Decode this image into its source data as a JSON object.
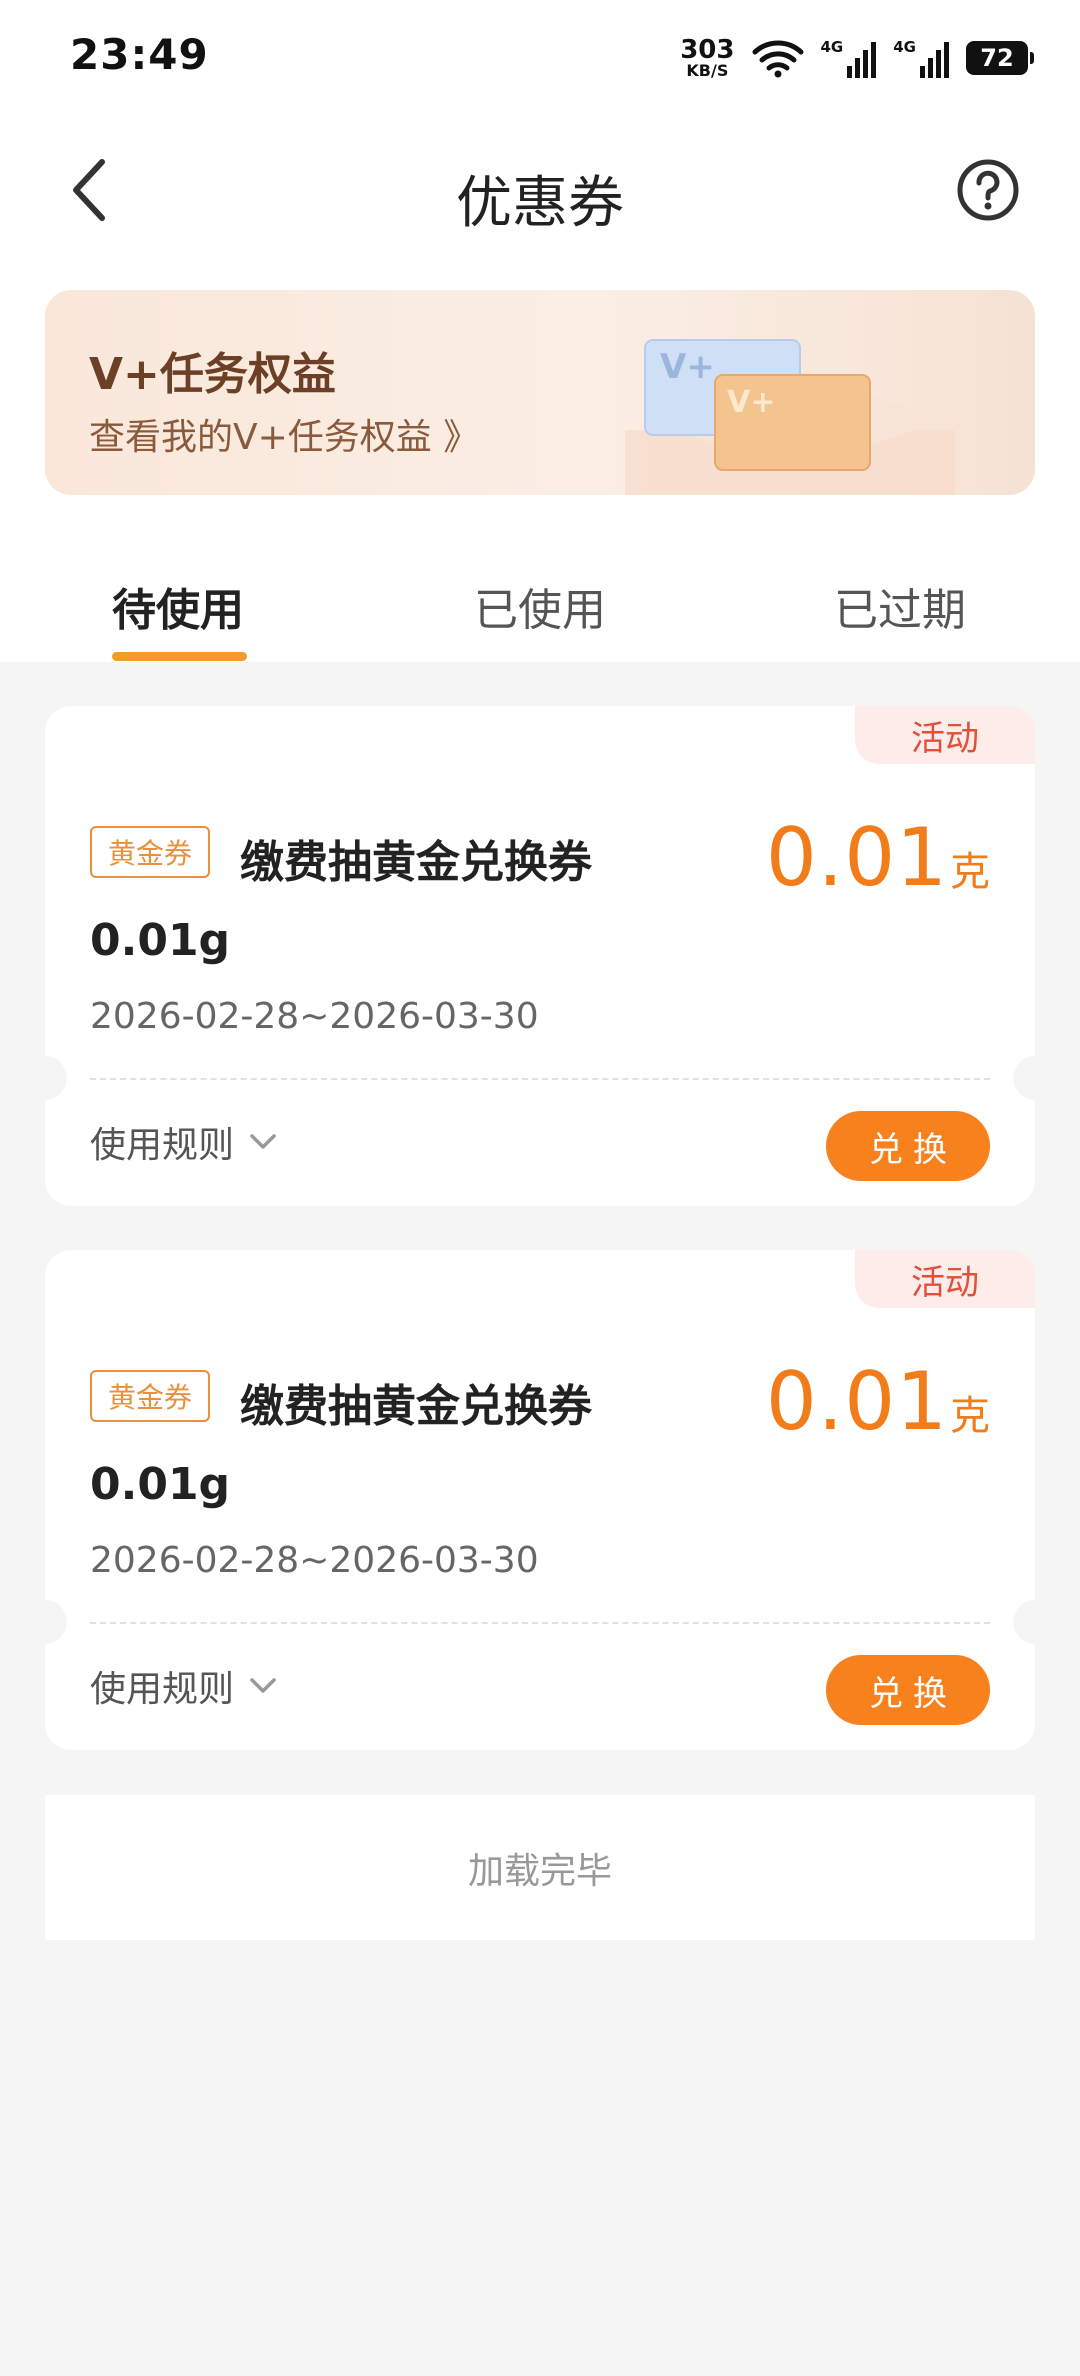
{
  "status_bar": {
    "time": "23:49",
    "net_speed_value": "303",
    "net_speed_unit": "KB/S",
    "signal_tag_1": "4G",
    "signal_tag_2": "4G",
    "battery": "72"
  },
  "header": {
    "title": "优惠券"
  },
  "banner": {
    "title": "V+任务权益",
    "subtitle": "查看我的V+任务权益 》"
  },
  "tabs": [
    {
      "label": "待使用"
    },
    {
      "label": "已使用"
    },
    {
      "label": "已过期"
    }
  ],
  "coupons": [
    {
      "badge": "活动",
      "tag": "黄金券",
      "title": "缴费抽黄金兑换券 0.01g",
      "amount": "0.01",
      "unit": "克",
      "date_range": "2026-02-28~2026-03-30",
      "rules_label": "使用规则",
      "button_label": "兑换"
    },
    {
      "badge": "活动",
      "tag": "黄金券",
      "title": "缴费抽黄金兑换券 0.01g",
      "amount": "0.01",
      "unit": "克",
      "date_range": "2026-02-28~2026-03-30",
      "rules_label": "使用规则",
      "button_label": "兑换"
    }
  ],
  "footer": {
    "load_complete": "加载完毕"
  }
}
